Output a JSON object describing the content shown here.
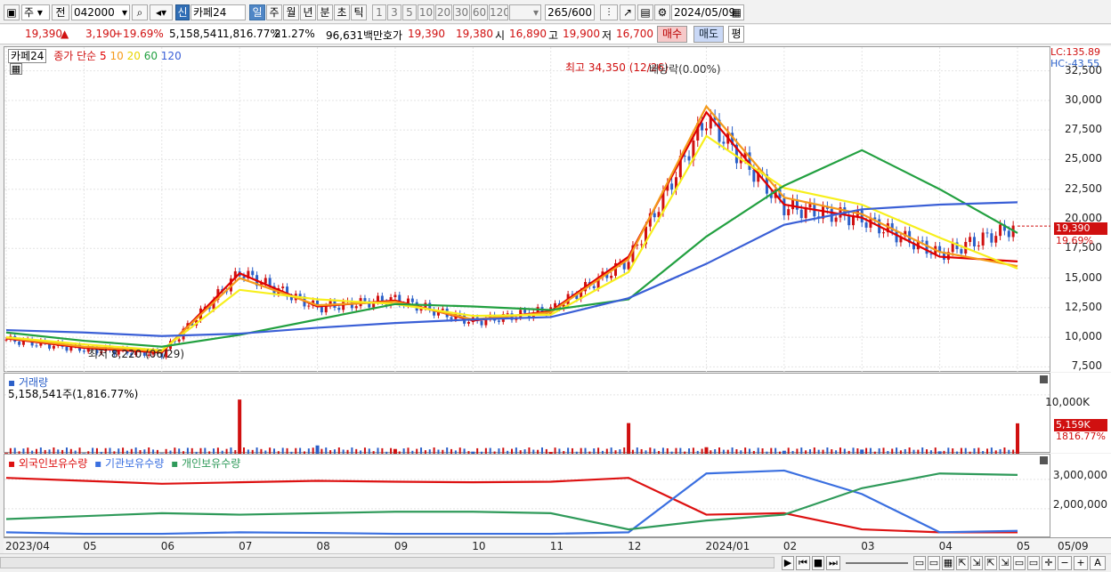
{
  "toolbar": {
    "period_unit": "주",
    "prev_label": "전",
    "code": "042000",
    "badge": "신",
    "stock_name": "카페24",
    "periods": [
      "일",
      "주",
      "월",
      "년",
      "분",
      "초",
      "틱"
    ],
    "selected_period": "일",
    "intervals": [
      "1",
      "3",
      "5",
      "10",
      "20",
      "30",
      "60",
      "120"
    ],
    "count": "265",
    "count_total": "/600",
    "date": "2024/05/09"
  },
  "quote": {
    "price": "19,390",
    "change_arrow": "▲",
    "change": "3,190",
    "change_pct": "+19.69%",
    "volume": "5,158,541",
    "volume_ratio": "1,816.77%",
    "turnover": "21.27%",
    "trade_value": "96,631백만",
    "bid_label": "호가",
    "ask_price": "19,390",
    "bid_price": "19,380",
    "open_label": "시",
    "open": "16,890",
    "high_label": "고",
    "high": "19,900",
    "low_label": "저",
    "low": "16,700",
    "buy_button": "매수",
    "sell_button": "매도",
    "eval_button": "평"
  },
  "price_panel": {
    "stock_tag": "카페24",
    "legend_prefix": "종가 단순",
    "ma_labels": [
      "5",
      "10",
      "20",
      "60",
      "120"
    ],
    "high_note": "최고 34,350 (12/26)",
    "low_note": "최저 8,220 (06/29)",
    "event_note": "배당락(0.00%)",
    "lc": "LC:135.89",
    "hc": "HC:-43.55",
    "yticks": [
      "32,500",
      "30,000",
      "27,500",
      "25,000",
      "22,500",
      "20,000",
      "17,500",
      "15,000",
      "12,500",
      "10,000",
      "7,500"
    ],
    "current_price_tag": "19,390",
    "current_pct_tag": "19.69%"
  },
  "volume_panel": {
    "title": "거래량",
    "value": "5,158,541주(1,816.77%)",
    "ytick": "10,000K",
    "current_tag": "5,159K",
    "current_pct_tag": "1816.77%"
  },
  "holding_panel": {
    "legend": [
      "외국인보유수량",
      "기관보유수량",
      "개인보유수량"
    ],
    "yticks": [
      "3,000,000",
      "2,000,000"
    ]
  },
  "date_axis": [
    "2023/04",
    "05",
    "06",
    "07",
    "08",
    "09",
    "10",
    "11",
    "12",
    "2024/01",
    "02",
    "03",
    "04",
    "05",
    "05/09"
  ],
  "colors": {
    "up": "#d01010",
    "down": "#2a5fc8",
    "ma5": "#e00000",
    "ma10": "#f59a1a",
    "ma20": "#f7ef1c",
    "ma60": "#22a040",
    "ma120": "#3a5fd6",
    "foreign": "#dd1111",
    "institution": "#3a6fe0",
    "individual": "#2f9a5a"
  },
  "chart_data": {
    "type": "line",
    "x": [
      "2023/04",
      "2023/05",
      "2023/06",
      "2023/07",
      "2023/08",
      "2023/09",
      "2023/10",
      "2023/11",
      "2023/12",
      "2024/01",
      "2024/02",
      "2024/03",
      "2024/04",
      "2024/05"
    ],
    "series": [
      {
        "name": "종가",
        "values": [
          9800,
          9000,
          8600,
          15500,
          12500,
          13200,
          11300,
          12300,
          16500,
          28500,
          21000,
          20000,
          17000,
          19390
        ]
      },
      {
        "name": "5",
        "values": [
          9900,
          9100,
          8700,
          15400,
          12600,
          13100,
          11400,
          12200,
          16800,
          29000,
          21200,
          20100,
          16800,
          16400
        ]
      },
      {
        "name": "10",
        "values": [
          9950,
          9200,
          8800,
          15000,
          12700,
          13000,
          11500,
          12100,
          16600,
          29500,
          21800,
          20400,
          17200,
          16000
        ]
      },
      {
        "name": "20",
        "values": [
          10000,
          9400,
          8900,
          14000,
          13200,
          12800,
          11800,
          11900,
          15500,
          27000,
          22600,
          21200,
          18400,
          15800
        ]
      },
      {
        "name": "60",
        "values": [
          10400,
          9700,
          9200,
          10200,
          11500,
          12800,
          12600,
          12300,
          13200,
          18500,
          22800,
          25800,
          22500,
          18800
        ]
      },
      {
        "name": "120",
        "values": [
          10600,
          10400,
          10100,
          10300,
          10800,
          11200,
          11500,
          11700,
          13300,
          16200,
          19500,
          20800,
          21200,
          21400
        ]
      }
    ],
    "ylim": [
      7000,
      34500
    ],
    "volume_series": [
      {
        "name": "거래량 (K)",
        "values": [
          120,
          90,
          80,
          9200,
          1400,
          800,
          350,
          300,
          5200,
          1100,
          500,
          700,
          400,
          5159
        ]
      }
    ],
    "holding_series": [
      {
        "name": "외국인보유수량",
        "values": [
          3050000,
          2950000,
          2850000,
          2900000,
          2950000,
          2920000,
          2900000,
          2920000,
          3050000,
          1800000,
          1850000,
          1300000,
          1200000,
          1200000
        ]
      },
      {
        "name": "기관보유수량",
        "values": [
          1200000,
          1150000,
          1150000,
          1200000,
          1180000,
          1150000,
          1150000,
          1150000,
          1200000,
          3200000,
          3300000,
          2500000,
          1200000,
          1250000
        ]
      },
      {
        "name": "개인보유수량",
        "values": [
          1650000,
          1750000,
          1850000,
          1800000,
          1850000,
          1900000,
          1900000,
          1850000,
          1300000,
          1600000,
          1800000,
          2700000,
          3200000,
          3150000
        ]
      }
    ]
  }
}
